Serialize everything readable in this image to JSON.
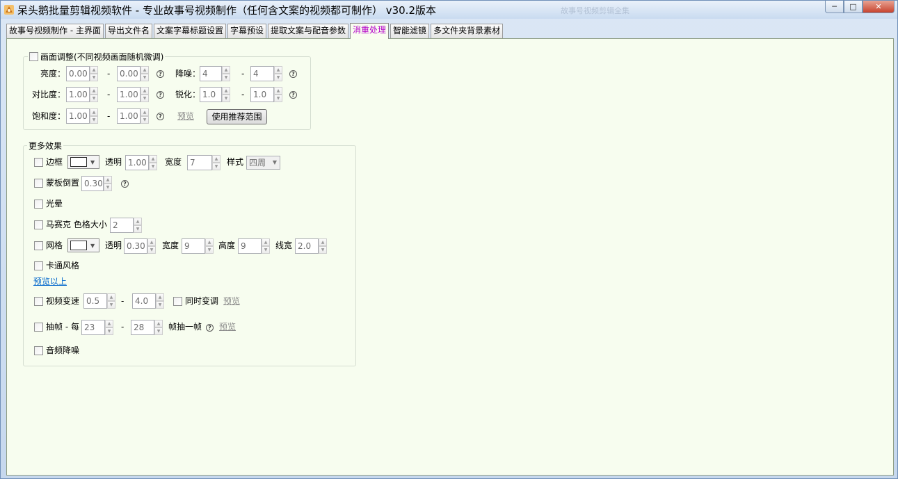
{
  "window": {
    "title": "呆头鹅批量剪辑视频软件 -  专业故事号视频制作（任何含文案的视频都可制作）  v30.2版本",
    "ghost_title": "故事号视频剪辑全集",
    "minimize": "─",
    "maximize": "□",
    "close": "✕"
  },
  "tabs": [
    {
      "label": "故事号视频制作 - 主界面"
    },
    {
      "label": "导出文件名"
    },
    {
      "label": "文案字幕标题设置"
    },
    {
      "label": "字幕预设"
    },
    {
      "label": "提取文案与配音参数"
    },
    {
      "label": "消重处理"
    },
    {
      "label": "智能滤镜"
    },
    {
      "label": "多文件夹背景素材"
    }
  ],
  "picture_adjust": {
    "title": "画面调整(不同视频画面随机微调)",
    "brightness": {
      "label": "亮度：",
      "min": "0.00",
      "max": "0.00"
    },
    "contrast": {
      "label": "对比度：",
      "min": "1.00",
      "max": "1.00"
    },
    "saturation": {
      "label": "饱和度：",
      "min": "1.00",
      "max": "1.00"
    },
    "denoise": {
      "label": "降噪：",
      "min": "4",
      "max": "4"
    },
    "sharpen": {
      "label": "锐化：",
      "min": "1.0",
      "max": "1.0"
    },
    "dash": "-",
    "preview": "预览",
    "recommend_button": "使用推荐范围",
    "help": "?"
  },
  "more_effects": {
    "title": "更多效果",
    "border": {
      "label": "边框",
      "opacity_label": "透明",
      "opacity": "1.00",
      "width_label": "宽度",
      "width": "7",
      "style_label": "样式",
      "style": "四周"
    },
    "mask_flip": {
      "label": "蒙板倒置",
      "value": "0.30"
    },
    "halo": {
      "label": "光晕"
    },
    "mosaic": {
      "label": "马赛克  色格大小",
      "value": "2"
    },
    "grid": {
      "label": "网格",
      "opacity_label": "透明",
      "opacity": "0.30",
      "width_label": "宽度",
      "width": "9",
      "height_label": "高度",
      "height": "9",
      "line_label": "线宽",
      "line": "2.0"
    },
    "cartoon": {
      "label": "卡通风格"
    },
    "preview_above": "预览以上",
    "speed": {
      "label": "视频变速",
      "min": "0.5",
      "max": "4.0",
      "sync_label": "同时变调",
      "preview": "预览"
    },
    "frame_drop": {
      "label": "抽帧 - 每",
      "min": "23",
      "max": "28",
      "suffix": "帧抽一帧",
      "preview": "预览"
    },
    "audio_denoise": {
      "label": "音频降噪"
    },
    "dash": "-",
    "help": "?"
  },
  "colors": {
    "panel_bg": "#f7fdef",
    "active_tab_text": "#b400c8",
    "link_blue": "#0066cc"
  }
}
